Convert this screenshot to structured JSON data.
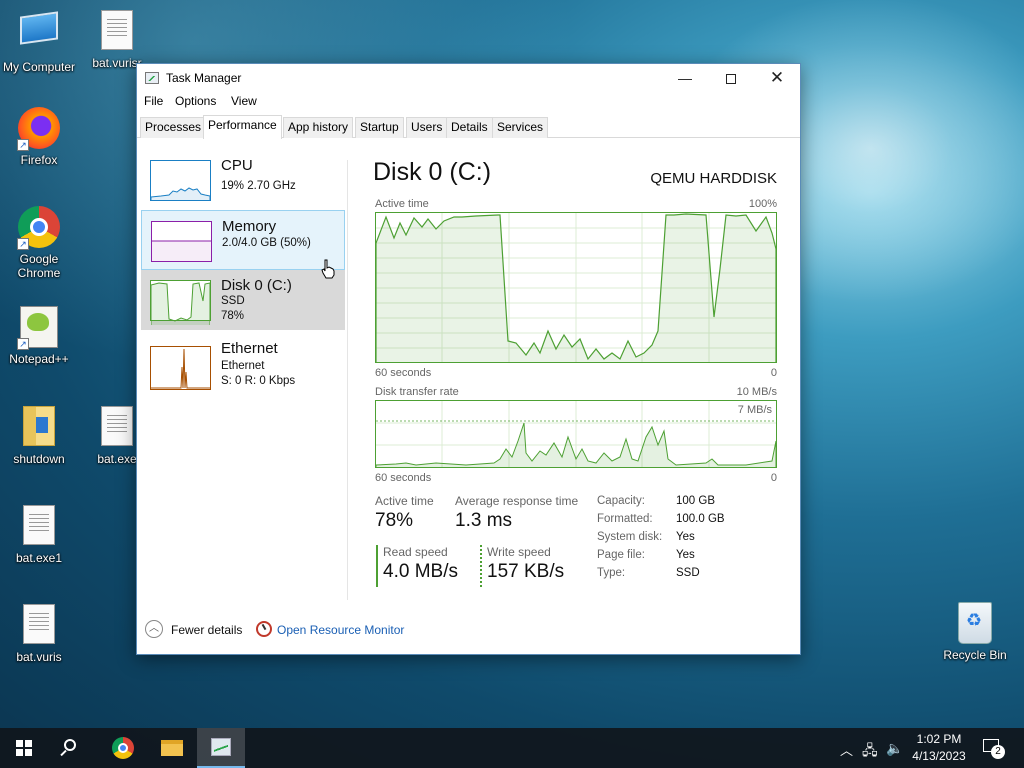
{
  "desktop": {
    "icons": [
      {
        "label": "My Computer"
      },
      {
        "label": "bat.vurisr"
      },
      {
        "label": "Firefox"
      },
      {
        "label": "Google Chrome"
      },
      {
        "label": "Notepad++"
      },
      {
        "label": "shutdown"
      },
      {
        "label": "bat.exe"
      },
      {
        "label": "bat.exe1"
      },
      {
        "label": "bat.vuris"
      },
      {
        "label": "Recycle Bin"
      }
    ]
  },
  "window": {
    "title": "Task Manager",
    "menu": [
      "File",
      "Options",
      "View"
    ],
    "tabs": [
      "Processes",
      "Performance",
      "App history",
      "Startup",
      "Users",
      "Details",
      "Services"
    ],
    "active_tab": "Performance"
  },
  "resources": [
    {
      "name": "CPU",
      "line1": "19%  2.70 GHz",
      "line2": ""
    },
    {
      "name": "Memory",
      "line1": "2.0/4.0 GB (50%)",
      "line2": ""
    },
    {
      "name": "Disk 0 (C:)",
      "line1": "SSD",
      "line2": "78%"
    },
    {
      "name": "Ethernet",
      "line1": "Ethernet",
      "line2_label": "S: 0 R: 0 Kbps"
    }
  ],
  "disk": {
    "title": "Disk 0 (C:)",
    "model": "QEMU HARDDISK",
    "active_time_label": "Active time",
    "active_time_max": "100%",
    "graph_time_label": "60 seconds",
    "graph_min": "0",
    "transfer_label": "Disk transfer rate",
    "transfer_max": "10 MB/s",
    "transfer_marker": "7 MB/s",
    "stats": {
      "active_time_label": "Active time",
      "active_time_value": "78%",
      "avg_response_label": "Average response time",
      "avg_response_value": "1.3 ms",
      "read_label": "Read speed",
      "read_value": "4.0 MB/s",
      "write_label": "Write speed",
      "write_value": "157 KB/s"
    },
    "details": [
      {
        "key": "Capacity:",
        "value": "100 GB"
      },
      {
        "key": "Formatted:",
        "value": "100.0 GB"
      },
      {
        "key": "System disk:",
        "value": "Yes"
      },
      {
        "key": "Page file:",
        "value": "Yes"
      },
      {
        "key": "Type:",
        "value": "SSD"
      }
    ]
  },
  "footer": {
    "fewer_details": "Fewer details",
    "resource_monitor": "Open Resource Monitor"
  },
  "taskbar": {
    "time": "1:02 PM",
    "date": "4/13/2023",
    "notification_count": "2"
  },
  "colors": {
    "disk_green": "#4da033",
    "memory_purple": "#8b1fa8",
    "cpu_blue": "#1a7fc4",
    "ethernet_orange": "#a74f01",
    "link_blue": "#1a5fb4"
  }
}
